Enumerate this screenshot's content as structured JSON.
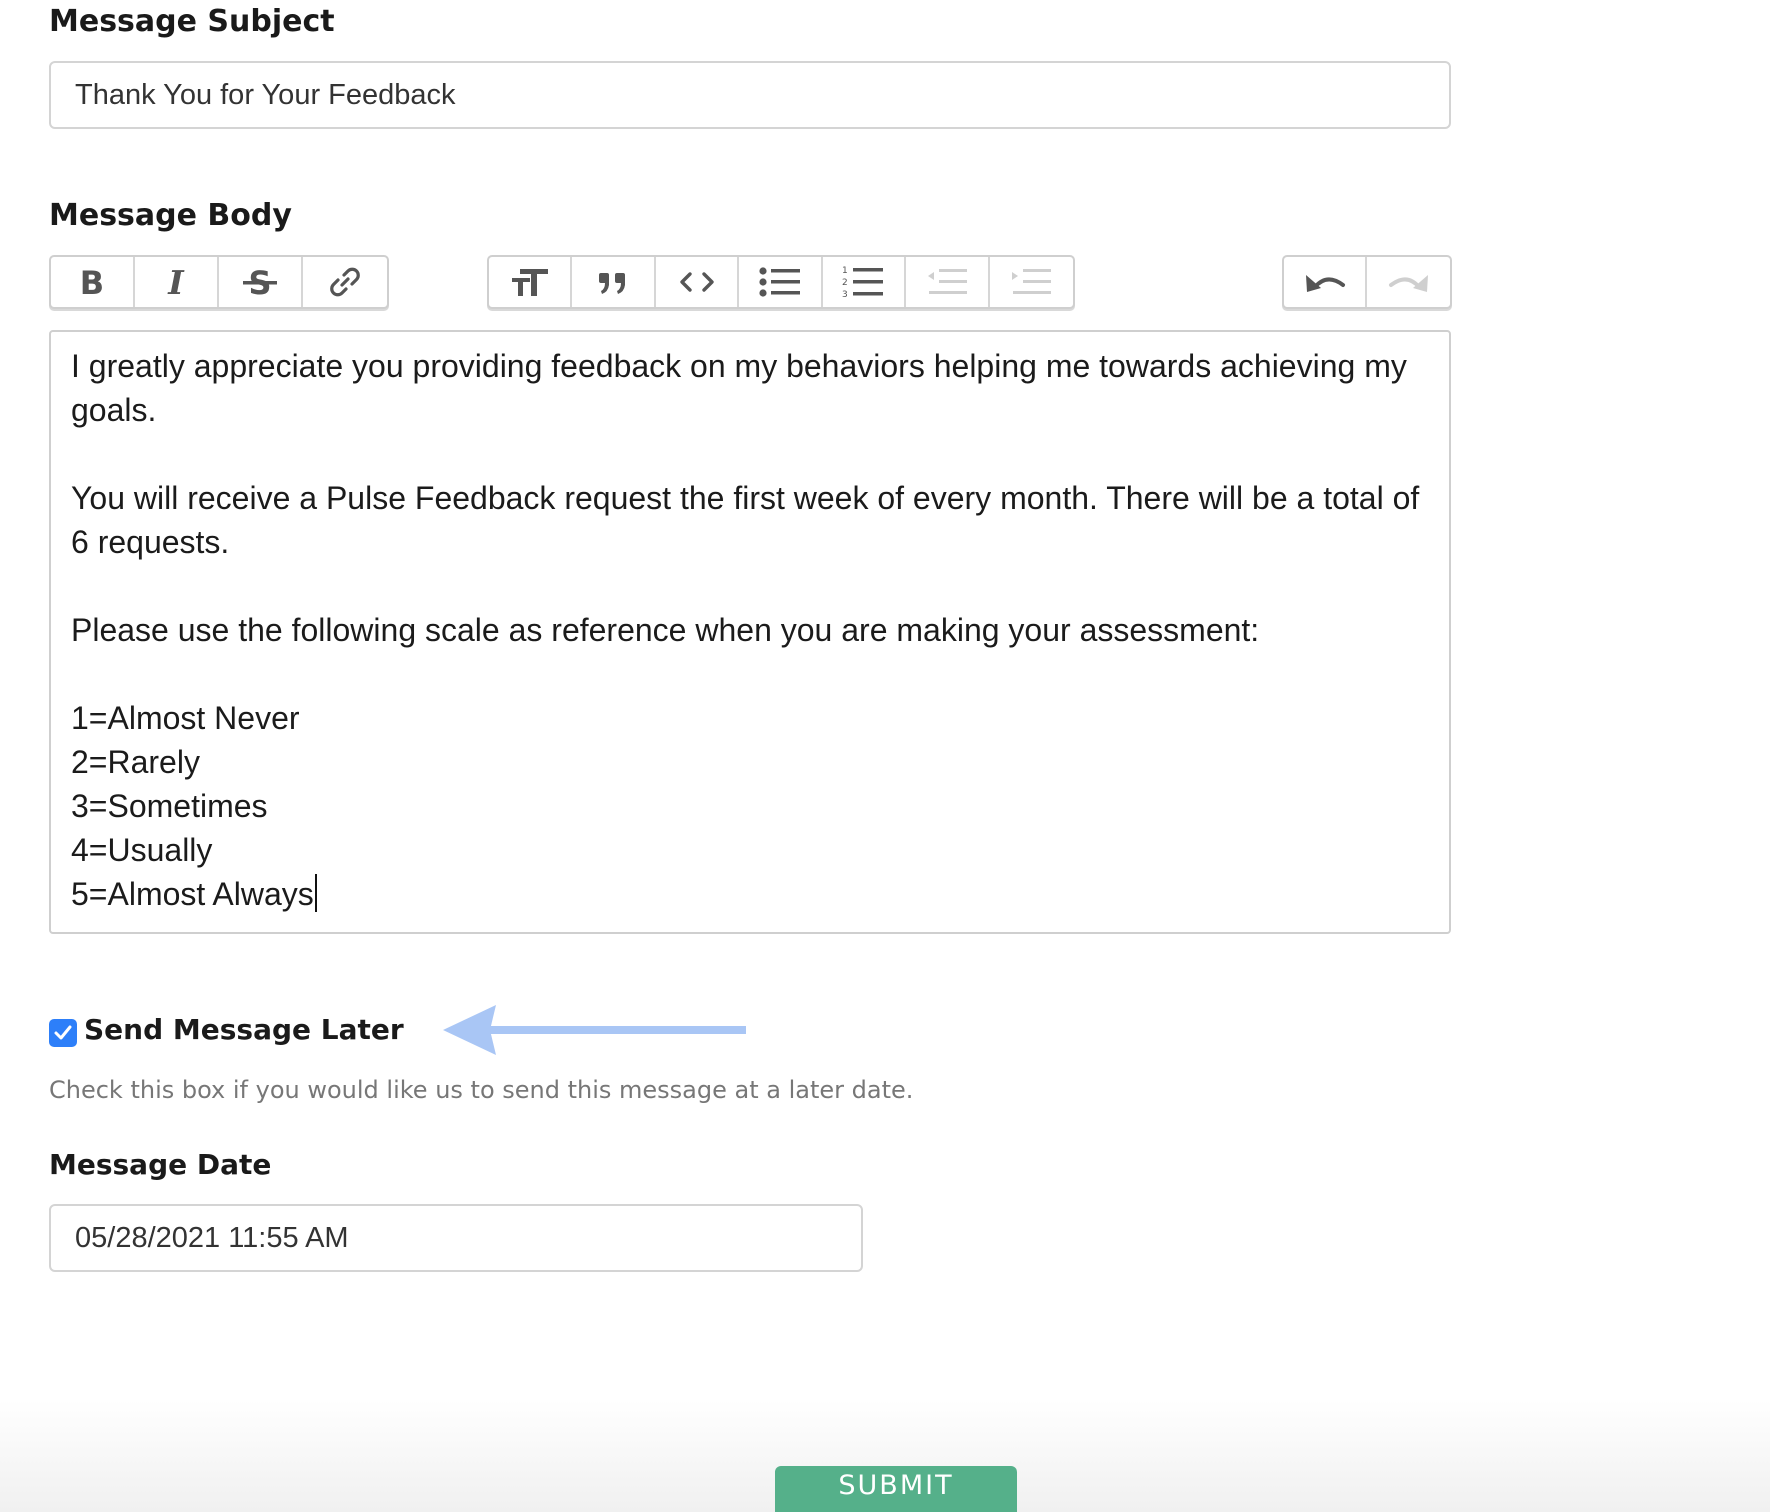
{
  "subject": {
    "label": "Message Subject",
    "value": "Thank You for Your Feedback"
  },
  "body": {
    "label": "Message Body",
    "toolbar": {
      "format_group": [
        "bold-icon",
        "italic-icon",
        "strikethrough-icon",
        "link-icon"
      ],
      "block_group": [
        "heading-icon",
        "quote-icon",
        "code-icon",
        "bullet-list-icon",
        "numbered-list-icon",
        "outdent-icon",
        "indent-icon"
      ],
      "history_group": [
        "undo-icon",
        "redo-icon"
      ]
    },
    "paragraphs": [
      "I greatly appreciate you providing feedback on my behaviors helping me towards achieving my goals.",
      "You will receive a Pulse Feedback request the first week of every month. There will be a total of 6 requests.",
      "Please use the following scale as reference when you are making your assessment:"
    ],
    "scale": [
      "1=Almost Never",
      "2=Rarely",
      "3=Sometimes",
      "4=Usually",
      "5=Almost Always"
    ]
  },
  "send_later": {
    "label": "Send Message Later",
    "checked": true,
    "help": "Check this box if you would like us to send this message at a later date.",
    "arrow_color": "#a9c6f5"
  },
  "message_date": {
    "label": "Message Date",
    "value": "05/28/2021 11:55 AM"
  },
  "submit": {
    "label": "SUBMIT",
    "color": "#55b08a"
  }
}
